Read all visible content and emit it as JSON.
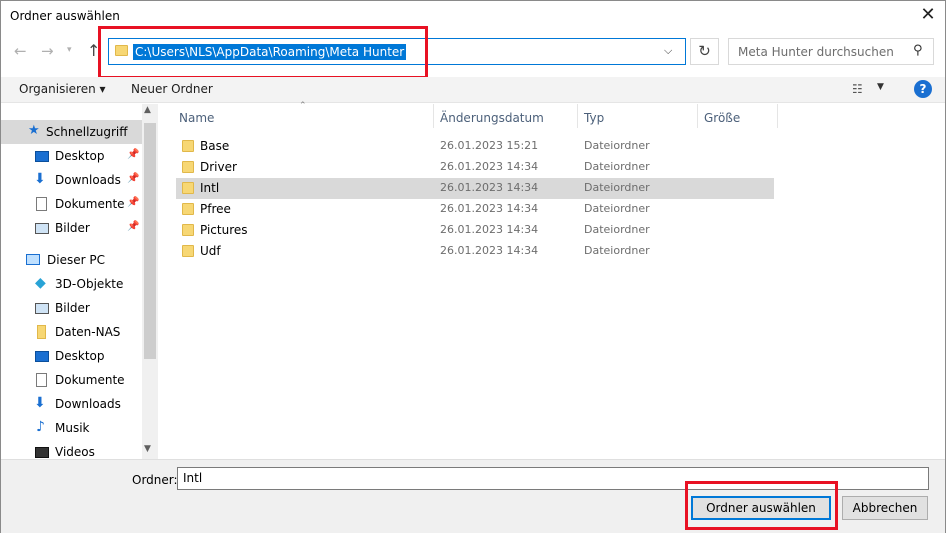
{
  "window": {
    "title": "Ordner auswählen",
    "close_glyph": "✕"
  },
  "nav": {
    "back_icon": "arrow-left-icon",
    "forward_icon": "arrow-right-icon",
    "recent_icon": "chevron-down-icon",
    "up_icon": "arrow-up-icon",
    "address": "C:\\Users\\NLS\\AppData\\Roaming\\Meta Hunter",
    "search_placeholder": "Meta Hunter durchsuchen"
  },
  "toolbar": {
    "organize_label": "Organisieren ▾",
    "new_folder_label": "Neuer Ordner",
    "help_label": "?"
  },
  "sidebar": {
    "items": [
      {
        "label": "Schnellzugriff",
        "icon": "star-icon",
        "pinned": false,
        "selected": true
      },
      {
        "label": "Desktop",
        "icon": "desktop-icon",
        "pinned": true
      },
      {
        "label": "Downloads",
        "icon": "download-icon",
        "pinned": true
      },
      {
        "label": "Dokumente",
        "icon": "document-icon",
        "pinned": true
      },
      {
        "label": "Bilder",
        "icon": "pictures-icon",
        "pinned": true
      },
      {
        "label": "Dieser PC",
        "icon": "computer-icon",
        "pinned": false
      },
      {
        "label": "3D-Objekte",
        "icon": "cube-icon",
        "pinned": false
      },
      {
        "label": "Bilder",
        "icon": "pictures-icon",
        "pinned": false
      },
      {
        "label": "Daten-NAS",
        "icon": "folder-icon",
        "pinned": false
      },
      {
        "label": "Desktop",
        "icon": "desktop-icon",
        "pinned": false
      },
      {
        "label": "Dokumente",
        "icon": "document-icon",
        "pinned": false
      },
      {
        "label": "Downloads",
        "icon": "download-icon",
        "pinned": false
      },
      {
        "label": "Musik",
        "icon": "music-icon",
        "pinned": false
      },
      {
        "label": "Videos",
        "icon": "video-icon",
        "pinned": false
      }
    ]
  },
  "filelist": {
    "columns": [
      "Name",
      "Änderungsdatum",
      "Typ",
      "Größe"
    ],
    "rows": [
      {
        "name": "Base",
        "date": "26.01.2023 15:21",
        "type": "Dateiordner",
        "selected": false
      },
      {
        "name": "Driver",
        "date": "26.01.2023 14:34",
        "type": "Dateiordner",
        "selected": false
      },
      {
        "name": "Intl",
        "date": "26.01.2023 14:34",
        "type": "Dateiordner",
        "selected": true
      },
      {
        "name": "Pfree",
        "date": "26.01.2023 14:34",
        "type": "Dateiordner",
        "selected": false
      },
      {
        "name": "Pictures",
        "date": "26.01.2023 14:34",
        "type": "Dateiordner",
        "selected": false
      },
      {
        "name": "Udf",
        "date": "26.01.2023 14:34",
        "type": "Dateiordner",
        "selected": false
      }
    ]
  },
  "footer": {
    "folder_label": "Ordner:",
    "folder_value": "Intl",
    "select_button": "Ordner auswählen",
    "cancel_button": "Abbrechen"
  },
  "colors": {
    "accent": "#0078d7",
    "highlight": "#e81123",
    "folder": "#f7d774",
    "selection": "#d9d9d9"
  }
}
